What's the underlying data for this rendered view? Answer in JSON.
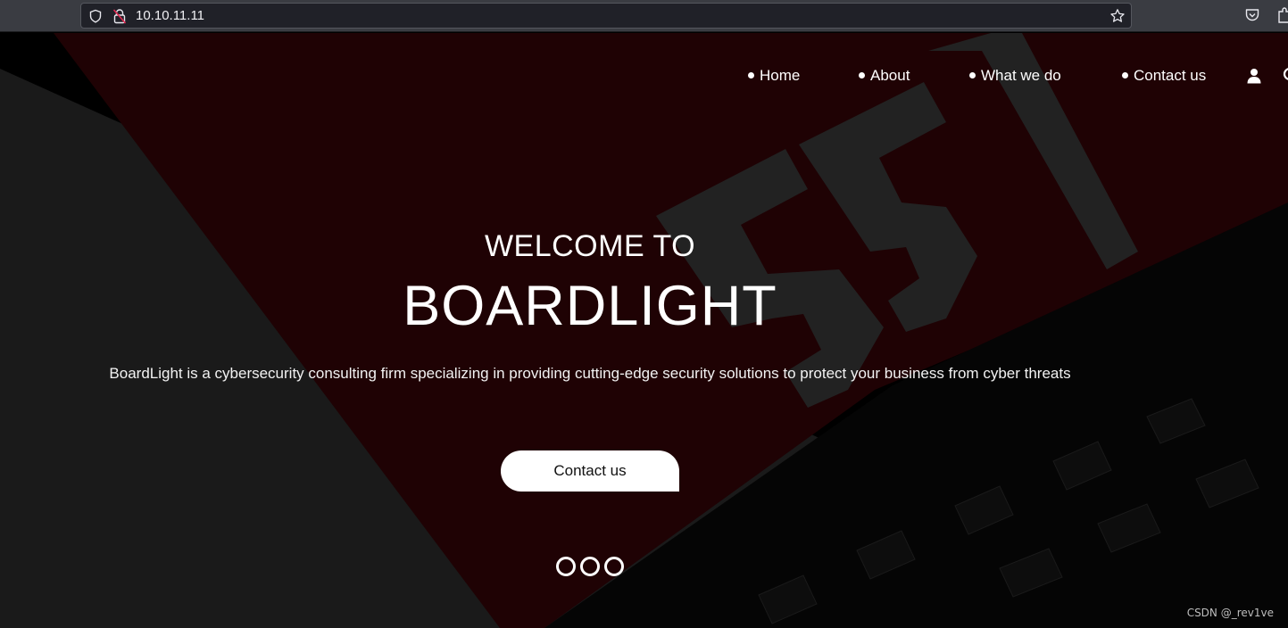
{
  "browser": {
    "url": "10.10.11.11",
    "icons": [
      "shield-icon",
      "insecure-lock-icon",
      "bookmark-star-icon",
      "pocket-icon",
      "extensions-icon"
    ]
  },
  "nav": {
    "items": [
      {
        "label": "Home"
      },
      {
        "label": "About"
      },
      {
        "label": "What we do"
      },
      {
        "label": "Contact us"
      }
    ],
    "icons": [
      "user-icon",
      "search-icon"
    ]
  },
  "hero": {
    "welcome": "WELCOME TO",
    "brand": "BOARDLIGHT",
    "description": "BoardLight is a cybersecurity consulting firm specializing in providing cutting-edge security solutions to protect your business from cyber threats",
    "cta_label": "Contact us",
    "slides_count": 3,
    "accent_color": "#1f0204"
  },
  "watermark": "CSDN @_rev1ve"
}
